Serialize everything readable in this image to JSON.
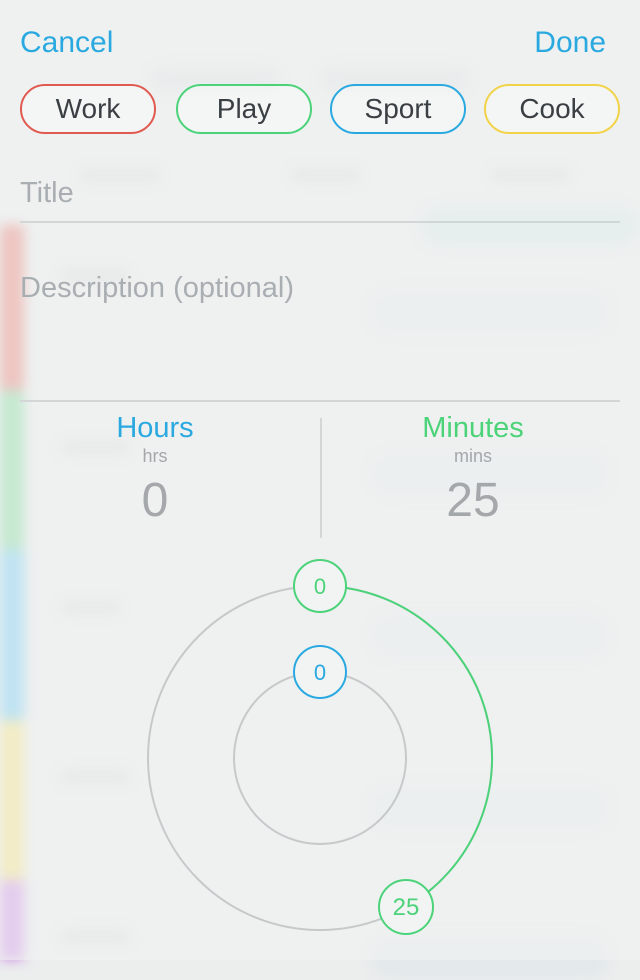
{
  "header": {
    "cancel_label": "Cancel",
    "done_label": "Done"
  },
  "categories": [
    {
      "label": "Work",
      "color": "#e15a4f"
    },
    {
      "label": "Play",
      "color": "#4cd37a"
    },
    {
      "label": "Sport",
      "color": "#2aa9e0"
    },
    {
      "label": "Cook",
      "color": "#f1d347"
    }
  ],
  "form": {
    "title_placeholder": "Title",
    "description_placeholder": "Description (optional)"
  },
  "duration": {
    "hours": {
      "label": "Hours",
      "unit": "hrs",
      "value": "0",
      "color": "#2aa9e0"
    },
    "minutes": {
      "label": "Minutes",
      "unit": "mins",
      "value": "25",
      "color": "#4cd37a"
    }
  },
  "dial": {
    "outer_start_label": "0",
    "inner_handle_label": "0",
    "minute_handle_label": "25",
    "minutes_fraction": 0.4167
  },
  "background_strip_colors": [
    "#e97a6f",
    "#7fd99a",
    "#6ec9f2",
    "#f3e27d",
    "#cf8fe6"
  ]
}
